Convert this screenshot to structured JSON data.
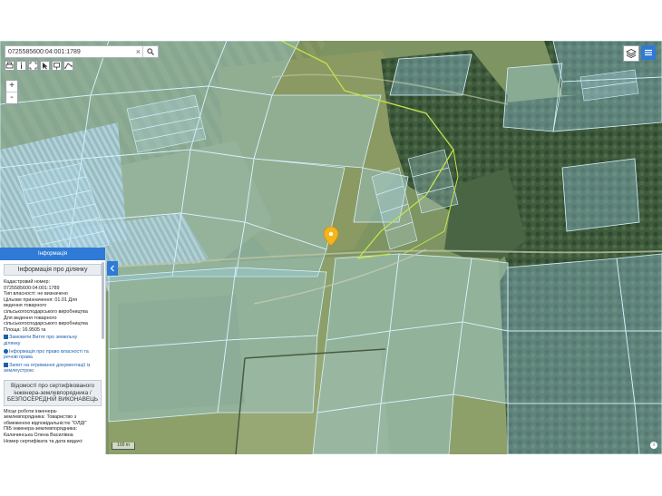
{
  "search": {
    "value": "0725585600:04:001:1789",
    "clear": "×"
  },
  "zoom": {
    "in": "+",
    "out": "-"
  },
  "scale": {
    "label": "100 m"
  },
  "attribution": "i",
  "panel": {
    "header": "Інформація",
    "title": "Інформація про ділянку",
    "lines": [
      "Кадастровий номер:",
      "0725585600:04:001:1789",
      "Тип власності: не визначено",
      "Цільове призначення: 01.01 Для",
      "ведення товарного",
      "сільськогосподарського виробництва",
      "Для ведення товарного",
      "сільськогосподарського виробництва",
      "Площа: 16.9505 га"
    ],
    "links": [
      "Замовити Витяг про земельну",
      "ділянку",
      "Інформація про право власності та",
      "речові права",
      "Запит на отримання документації із",
      "землеустрою"
    ],
    "engineer_box": [
      "Відомості про сертифікованого",
      "інженера-землевпорядника /",
      "БЕЗПОСЕРЕДНІЙ ВИКОНАВЕЦЬ"
    ],
    "engineer_lines": [
      "Місце роботи інженера-",
      "землевпорядника: Товариство з",
      "обмеженою відповідальністю \"ОЛДІ\"",
      "ПІБ інженера-землевпорядника:",
      "Калачинська Олена Василівна",
      "Номер сертифіката та дата видачі:"
    ]
  },
  "colors": {
    "accent": "#2f7ad6",
    "parcel_fill": "#9fd3f0",
    "parcel_stroke": "#d8f2ff",
    "boundary": "#c6e34a",
    "marker": "#f4b41a"
  }
}
